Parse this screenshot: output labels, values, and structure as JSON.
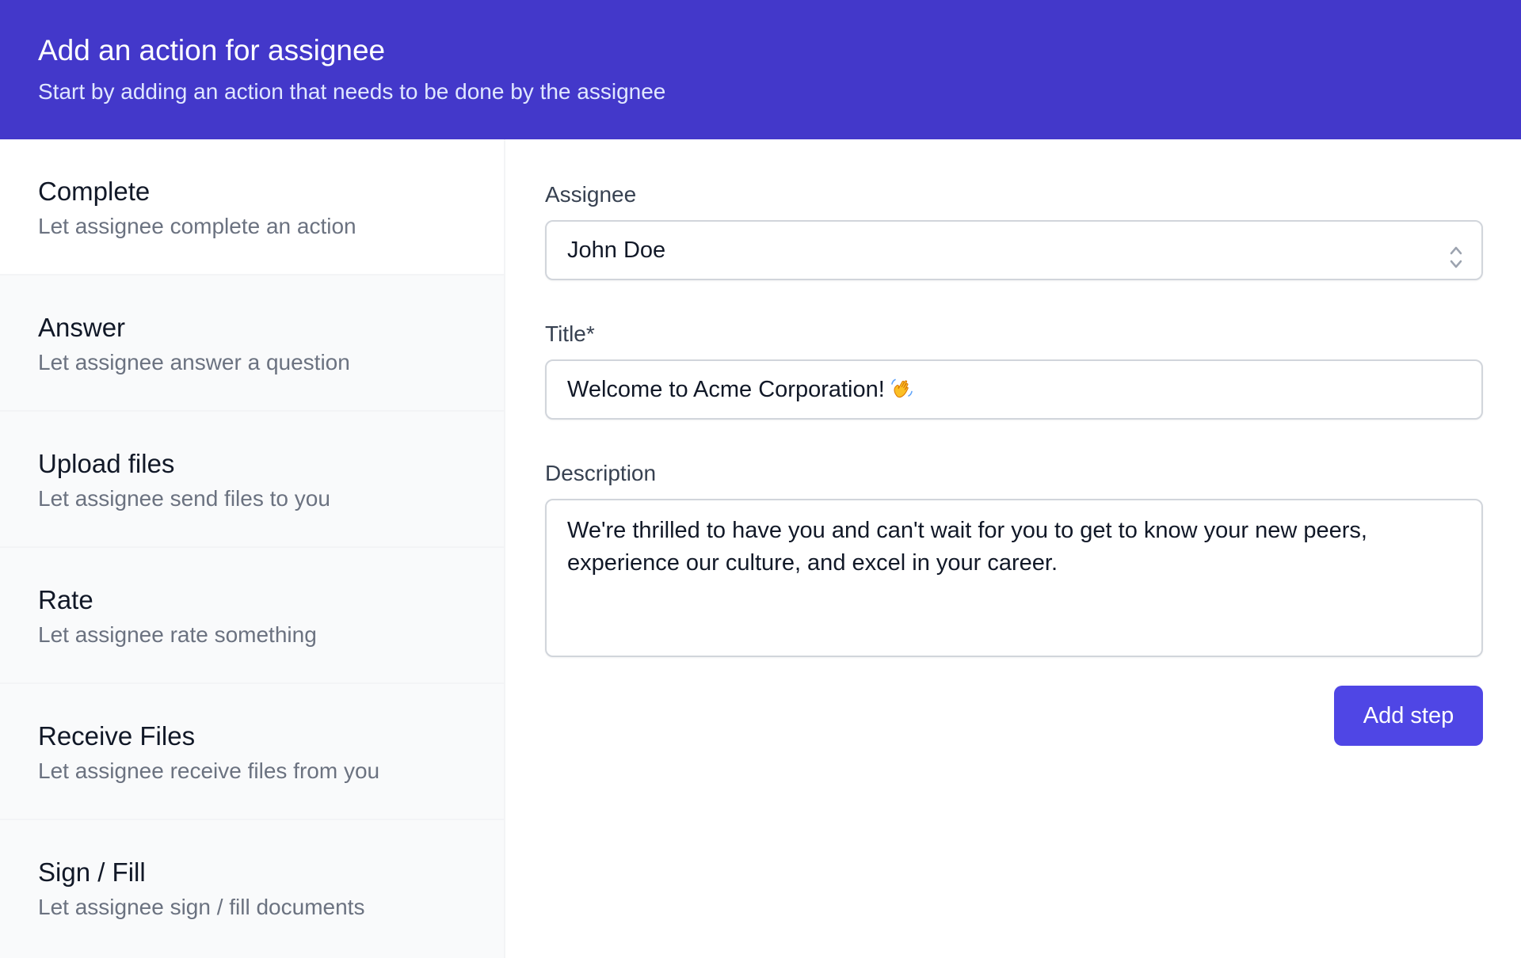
{
  "header": {
    "title": "Add an action for assignee",
    "subtitle": "Start by adding an action that needs to be done by the assignee"
  },
  "actions": [
    {
      "title": "Complete",
      "description": "Let assignee complete an action",
      "selected": true
    },
    {
      "title": "Answer",
      "description": "Let assignee answer a question",
      "selected": false
    },
    {
      "title": "Upload files",
      "description": "Let assignee send files to you",
      "selected": false
    },
    {
      "title": "Rate",
      "description": "Let assignee rate something",
      "selected": false
    },
    {
      "title": "Receive Files",
      "description": "Let assignee receive files from you",
      "selected": false
    },
    {
      "title": "Sign / Fill",
      "description": "Let assignee sign / fill documents",
      "selected": false
    }
  ],
  "form": {
    "assignee": {
      "label": "Assignee",
      "value": "John Doe"
    },
    "title": {
      "label": "Title*",
      "value": "Welcome to Acme Corporation!",
      "emoji": "waving-hand-icon"
    },
    "description": {
      "label": "Description",
      "value": "We're thrilled to have you and can't wait for you to get to know your new peers, experience our culture, and excel in your career."
    },
    "submit_label": "Add step"
  },
  "colors": {
    "header_bg": "#4338ca",
    "button_bg": "#4f46e5",
    "sidebar_bg": "#f9fafb"
  }
}
